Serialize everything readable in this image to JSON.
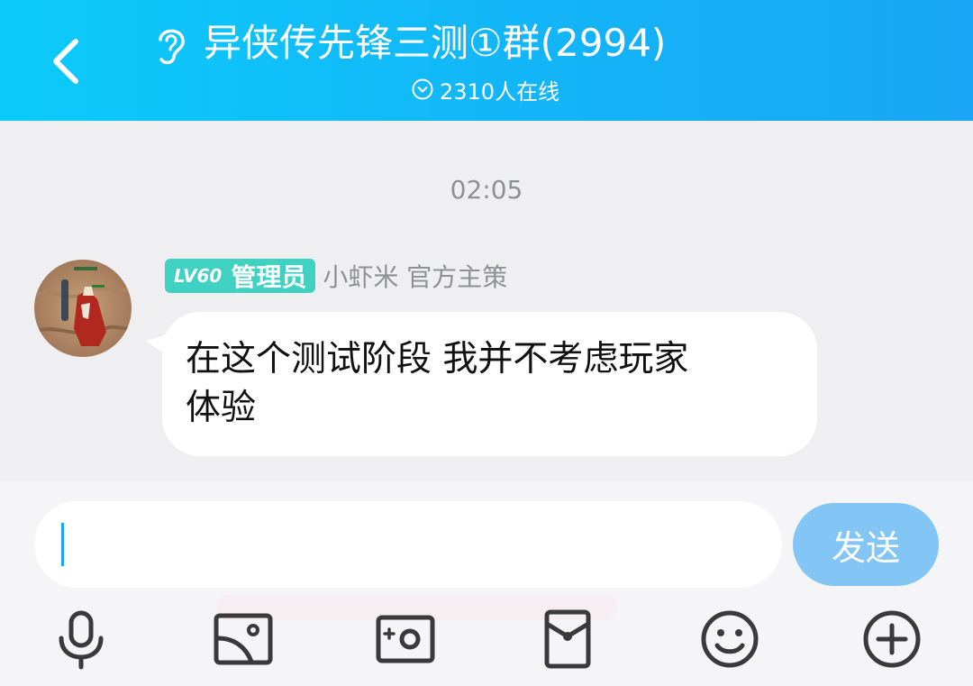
{
  "header": {
    "title": "异侠传先锋三测①群(2994)",
    "online": "2310人在线"
  },
  "chat": {
    "timestamp": "02:05",
    "message": {
      "level": "LV60",
      "role": "管理员",
      "sender": "小虾米 官方主策",
      "text": "在这个测试阶段 我并不考虑玩家\n体验"
    }
  },
  "input": {
    "value": "",
    "send_label": "发送"
  },
  "toolbar": {
    "icons": [
      "microphone-icon",
      "image-icon",
      "camera-icon",
      "red-packet-icon",
      "emoji-icon",
      "plus-icon"
    ]
  },
  "colors": {
    "header_start": "#0ccbfa",
    "header_end": "#1aa6f4",
    "badge": "#3fd1c1",
    "send_button": "#83c5f5",
    "background": "#efeff1"
  }
}
